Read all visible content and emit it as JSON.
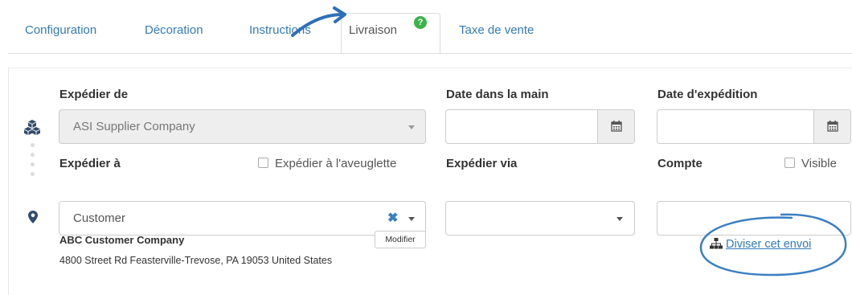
{
  "tabs": [
    {
      "label": "Configuration"
    },
    {
      "label": "Décoration"
    },
    {
      "label": "Instructions"
    },
    {
      "label": "Livraison",
      "active": true,
      "badge": "?"
    },
    {
      "label": "Taxe de vente"
    }
  ],
  "ship_from": {
    "label": "Expédier de",
    "value": "ASI Supplier Company"
  },
  "in_hands_date": {
    "label": "Date dans la main",
    "value": ""
  },
  "ship_date": {
    "label": "Date d'expédition",
    "value": ""
  },
  "ship_to": {
    "label": "Expédier à",
    "blind_ship_label": "Expédier à l'aveuglette",
    "blind_ship_checked": false,
    "value": "Customer"
  },
  "ship_via": {
    "label": "Expédier via",
    "value": ""
  },
  "account": {
    "label": "Compte",
    "visible_label": "Visible",
    "visible_checked": false,
    "value": ""
  },
  "address": {
    "company": "ABC Customer Company",
    "line": "4800 Street Rd Feasterville-Trevose, PA 19053 United States",
    "edit_label": "Modifier"
  },
  "split_shipment_label": "Diviser cet envoi",
  "colors": {
    "link": "#337ab7",
    "annotation": "#3a7fc1",
    "badge": "#3bb34a"
  },
  "icons": [
    "boxes-icon",
    "map-marker-icon",
    "calendar-icon",
    "sitemap-icon",
    "question-icon"
  ]
}
